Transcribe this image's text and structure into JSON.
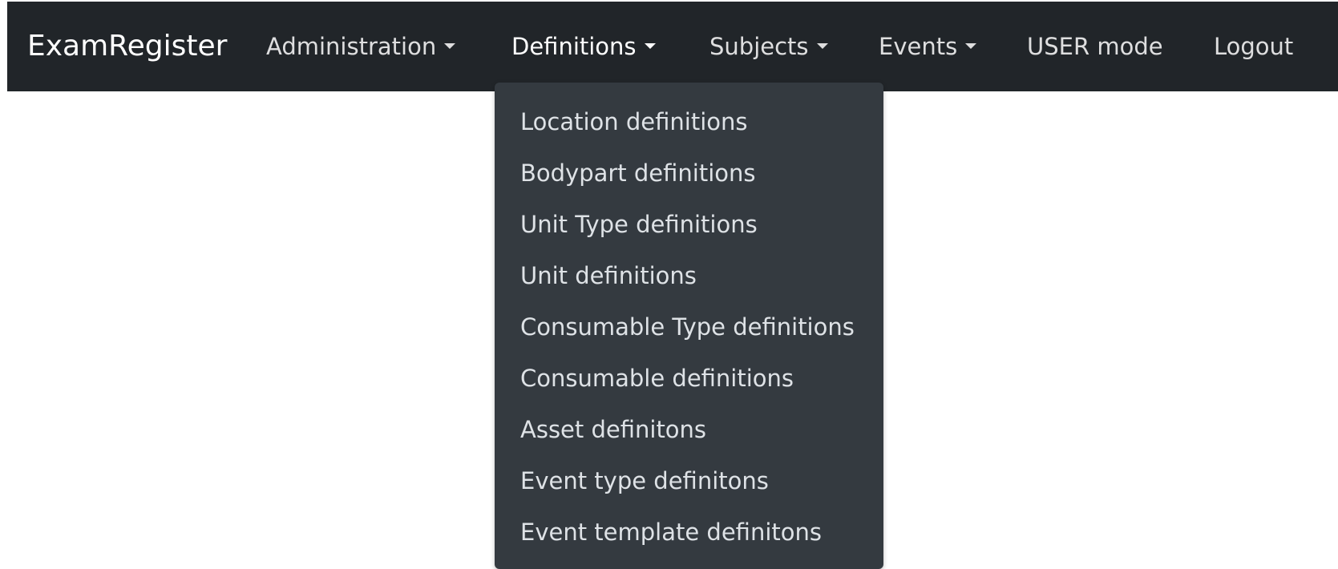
{
  "navbar": {
    "brand": "ExamRegister",
    "items": [
      {
        "label": "Administration",
        "dropdown": true
      },
      {
        "label": "Definitions",
        "dropdown": true
      },
      {
        "label": "Subjects",
        "dropdown": true
      },
      {
        "label": "Events",
        "dropdown": true
      },
      {
        "label": "USER mode",
        "dropdown": false
      },
      {
        "label": "Logout",
        "dropdown": false
      }
    ]
  },
  "dropdown": {
    "items": [
      "Location definitions",
      "Bodypart definitions",
      "Unit Type definitions",
      "Unit definitions",
      "Consumable Type definitions",
      "Consumable definitions",
      "Asset definitons",
      "Event type definitons",
      "Event template definitons"
    ]
  },
  "colors": {
    "navbar_bg": "#212529",
    "dropdown_bg": "#343a40",
    "text": "#ffffff"
  },
  "icons": {
    "caret": "caret-down-icon"
  }
}
